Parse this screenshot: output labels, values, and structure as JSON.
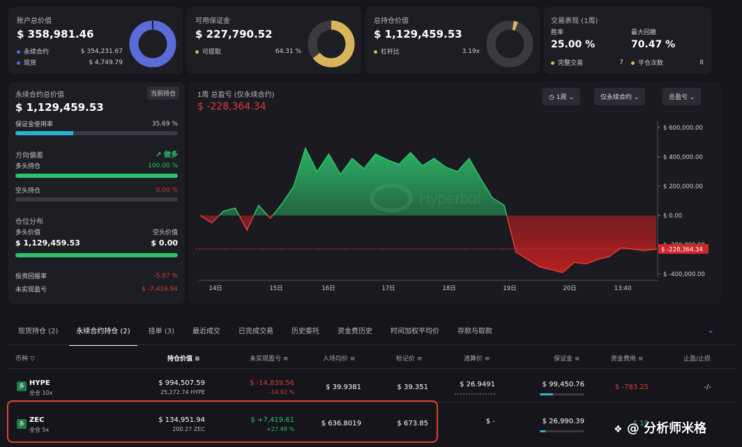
{
  "summary": {
    "account": {
      "label": "账户总价值",
      "value": "$ 358,981.46",
      "rows": [
        {
          "label": "永续合约",
          "value": "$ 354,231.67",
          "color": "#5b6bd8"
        },
        {
          "label": "现货",
          "value": "$ 4,749.79",
          "color": "#5b6bd8"
        }
      ]
    },
    "margin": {
      "label": "可用保证金",
      "value": "$ 227,790.52",
      "row": {
        "label": "可提取",
        "value": "64.31 %",
        "color": "#d8b45a"
      },
      "fraction": 0.6431
    },
    "position": {
      "label": "总持仓价值",
      "value": "$ 1,129,459.53",
      "row": {
        "label": "杠杆比",
        "value": "3.19x",
        "color": "#d8b45a"
      },
      "fraction": 0.03
    },
    "performance": {
      "label": "交易表现 (1周)",
      "win_label": "胜率",
      "win_value": "25.00 %",
      "dd_label": "最大回撤",
      "dd_value": "70.47 %",
      "done_label": "完整交易",
      "done_value": "7",
      "close_label": "平仓次数",
      "close_value": "8"
    }
  },
  "perp": {
    "label": "永续合约总价值",
    "badge": "当前持仓",
    "value": "$ 1,129,459.53",
    "usage_label": "保证金使用率",
    "usage_value": "35.69 %",
    "usage_fraction": 0.3569,
    "bias_label": "方向偏差",
    "bias_value": "做多",
    "long_label": "多头持仓",
    "long_value": "100.00 %",
    "long_fraction": 1.0,
    "short_label": "空头持仓",
    "short_value": "0.00 %",
    "short_fraction": 0.0,
    "dist_label": "仓位分布",
    "long_val_label": "多头价值",
    "long_val": "$ 1,129,459.53",
    "short_val_label": "空头价值",
    "short_val": "$ 0.00",
    "roi_label": "投资回报率",
    "roi_value": "-5.87 %",
    "upnl_label": "未实现盈亏",
    "upnl_value": "$ -7,419.94"
  },
  "chart_header": {
    "title": "1周 总盈亏 (仅永续合约)",
    "value": "$ -228,364.34",
    "btn_period": "1周",
    "btn_scope": "仅永续合约",
    "btn_metric": "总盈亏",
    "watermark": "Hyperbot"
  },
  "chart_data": {
    "type": "area",
    "x_labels": [
      "14日",
      "15日",
      "16日",
      "17日",
      "18日",
      "19日",
      "20日",
      "13:40"
    ],
    "y_ticks": [
      "$ 600,000.00",
      "$ 400,000.00",
      "$ 200,000.00",
      "$ 0.00",
      "$ -200,000.00",
      "$ -400,000.00"
    ],
    "ylim": [
      -400000,
      600000
    ],
    "current_label": "$ -228,364.34",
    "current_value": -228364.34,
    "values": [
      0,
      -50000,
      30000,
      50000,
      -100000,
      70000,
      -20000,
      80000,
      200000,
      460000,
      300000,
      420000,
      280000,
      390000,
      320000,
      420000,
      380000,
      350000,
      430000,
      340000,
      390000,
      330000,
      300000,
      390000,
      250000,
      120000,
      70000,
      -250000,
      -300000,
      -350000,
      -370000,
      -390000,
      -320000,
      -330000,
      -300000,
      -280000,
      -220000,
      -230000,
      -240000,
      -228364
    ]
  },
  "tabs": [
    "现货持仓 (2)",
    "永续合约持仓 (2)",
    "挂单 (3)",
    "最近成交",
    "已完成交易",
    "历史委托",
    "资金费历史",
    "时间加权平均价",
    "存款与取款"
  ],
  "table": {
    "headers": [
      "币种",
      "持仓价值",
      "未实现盈亏",
      "入场均价",
      "标记价",
      "清算价",
      "保证金",
      "资金费用",
      "止盈/止损"
    ],
    "rows": [
      {
        "icon": "多",
        "coin": "HYPE",
        "sub": "全仓 10x",
        "pos": "$ 994,507.59",
        "pos_sub": "25,272.74 HYPE",
        "pnl": "$ -14,839.56",
        "pnl_pct": "-14.92 %",
        "entry": "$ 39.9381",
        "mark": "$ 39.351",
        "liq": "$ 26.9491",
        "margin": "$ 99,450.76",
        "funding": "$ -783.25",
        "tpsl": "-/-",
        "positive": false,
        "margin_fraction": 0.3
      },
      {
        "icon": "多",
        "coin": "ZEC",
        "sub": "全仓 5x",
        "pos": "$ 134,951.94",
        "pos_sub": "200.27 ZEC",
        "pnl": "$ +7,419.61",
        "pnl_pct": "+27.49 %",
        "entry": "$ 636.8019",
        "mark": "$ 673.85",
        "liq": "$ -",
        "margin": "$ 26,990.39",
        "funding": "$ 18",
        "tpsl": "",
        "positive": true,
        "margin_fraction": 0.12
      }
    ]
  },
  "watermark_text": "@ 分析师米格"
}
